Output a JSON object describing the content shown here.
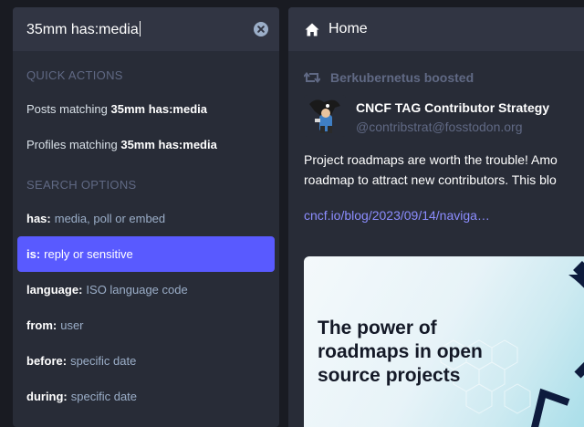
{
  "search": {
    "query": "35mm has:media"
  },
  "quick_actions": {
    "heading": "QUICK ACTIONS",
    "items": [
      {
        "prefix": "Posts matching",
        "query": "35mm has:media"
      },
      {
        "prefix": "Profiles matching",
        "query": "35mm has:media"
      }
    ]
  },
  "search_options": {
    "heading": "SEARCH OPTIONS",
    "items": [
      {
        "key": "has:",
        "desc": "media, poll or embed"
      },
      {
        "key": "is:",
        "desc": "reply or sensitive"
      },
      {
        "key": "language:",
        "desc": "ISO language code"
      },
      {
        "key": "from:",
        "desc": "user"
      },
      {
        "key": "before:",
        "desc": "specific date"
      },
      {
        "key": "during:",
        "desc": "specific date"
      }
    ]
  },
  "home": {
    "title": "Home"
  },
  "status": {
    "boosted_by": "Berkubernetus boosted",
    "display_name": "CNCF TAG Contributor Strategy",
    "acct": "@contribstrat@fosstodon.org",
    "text_line1": "Project roadmaps are worth the trouble!  Amo",
    "text_line2": "roadmap to attract new contributors.  This blo",
    "link": "cncf.io/blog/2023/09/14/naviga…",
    "card_title": "The power of roadmaps in open source projects"
  },
  "colors": {
    "accent": "#595aff",
    "link": "#8c8dff",
    "panel": "#282c37",
    "header": "#313543",
    "background": "#191b22"
  },
  "icons": [
    "clear-icon",
    "home-icon",
    "boost-icon"
  ]
}
